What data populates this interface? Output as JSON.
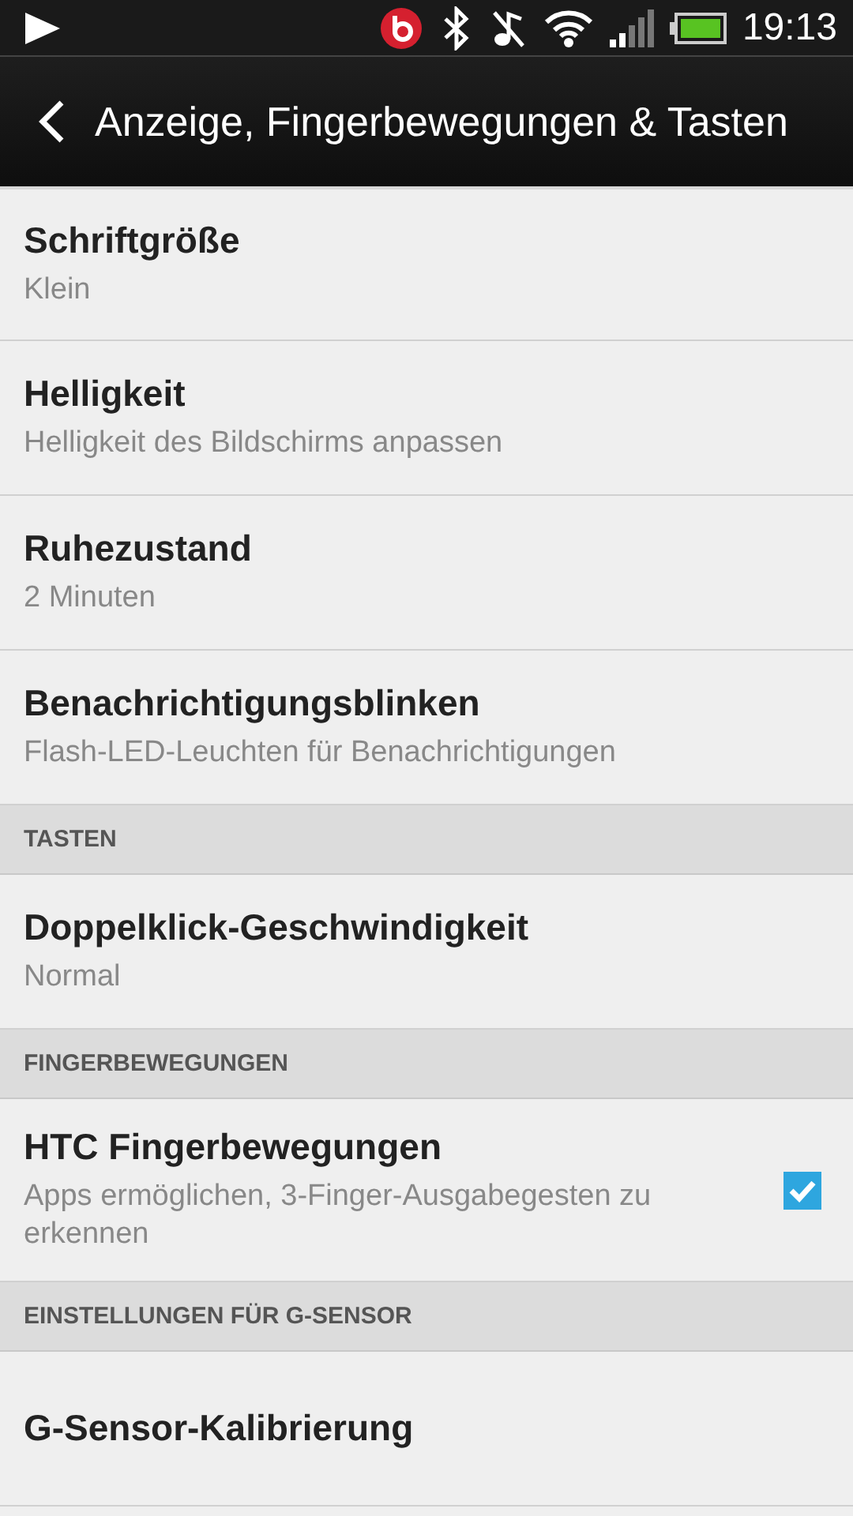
{
  "status_bar": {
    "time": "19:13"
  },
  "title_bar": {
    "title": "Anzeige, Fingerbewegungen & Tasten"
  },
  "items": [
    {
      "kind": "setting",
      "title": "Schriftgröße",
      "subtitle": "Klein"
    },
    {
      "kind": "setting",
      "title": "Helligkeit",
      "subtitle": "Helligkeit des Bildschirms anpassen"
    },
    {
      "kind": "setting",
      "title": "Ruhezustand",
      "subtitle": "2 Minuten"
    },
    {
      "kind": "setting",
      "title": "Benachrichtigungsblinken",
      "subtitle": "Flash-LED-Leuchten für Benachrichtigungen"
    },
    {
      "kind": "header",
      "title": "TASTEN"
    },
    {
      "kind": "setting",
      "title": "Doppelklick-Geschwindigkeit",
      "subtitle": "Normal"
    },
    {
      "kind": "header",
      "title": "FINGERBEWEGUNGEN"
    },
    {
      "kind": "checkbox",
      "title": "HTC Fingerbewegungen",
      "subtitle": "Apps ermöglichen, 3-Finger-Ausgabegesten zu erkennen",
      "checked": true
    },
    {
      "kind": "header",
      "title": "EINSTELLUNGEN FÜR G-SENSOR"
    },
    {
      "kind": "setting",
      "title": "G-Sensor-Kalibrierung"
    }
  ]
}
